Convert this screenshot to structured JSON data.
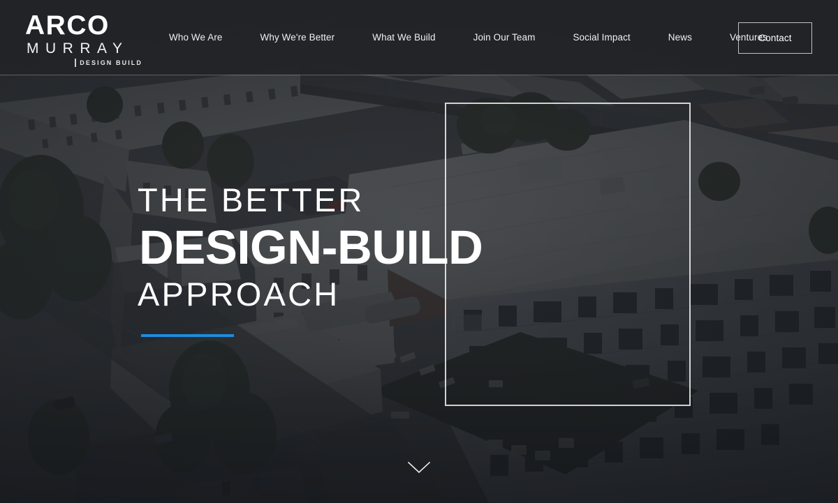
{
  "site": {
    "brand": {
      "primary": "ARCO",
      "secondary": "MURRAY",
      "tagline": "DESIGN BUILD"
    }
  },
  "header": {
    "nav_items": [
      {
        "label": "Who We Are",
        "name": "nav-who-we-are"
      },
      {
        "label": "Why We're Better",
        "name": "nav-why-were-better"
      },
      {
        "label": "What We Build",
        "name": "nav-what-we-build"
      },
      {
        "label": "Join Our Team",
        "name": "nav-join-our-team"
      },
      {
        "label": "Social Impact",
        "name": "nav-social-impact"
      },
      {
        "label": "News",
        "name": "nav-news"
      },
      {
        "label": "Ventures",
        "name": "nav-ventures"
      }
    ],
    "contact_label": "Contact"
  },
  "hero": {
    "line1": "THE BETTER",
    "line2": "DESIGN-BUILD",
    "line3": "APPROACH",
    "accent_color": "#1b8de0",
    "scroll_icon": "chevron-down-icon"
  },
  "colors": {
    "header_background": "#222427",
    "text_on_dark": "#ffffff",
    "accent_blue": "#1b8de0",
    "frame_border": "rgba(255,255,255,0.80)"
  }
}
